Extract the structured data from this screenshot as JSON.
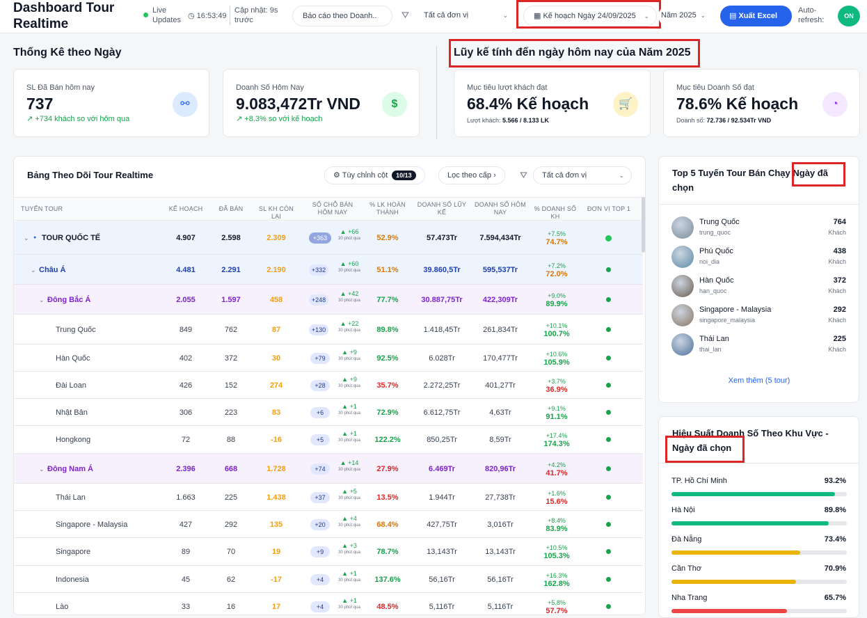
{
  "header": {
    "title": "Dashboard Tour Realtime",
    "live_label": "Live Updates",
    "clock": "16:53:49",
    "updated": "Cập nhật: 9s trước",
    "report_select": "Báo cáo theo Doanh..",
    "unit_select": "Tất cả đơn vị",
    "plan_select": "Kế hoạch Ngày 24/09/2025",
    "year_select": "Năm 2025",
    "export_label": "Xuất Excel",
    "auto_refresh_label": "Auto-refresh:",
    "toggle_label": "ON"
  },
  "daily": {
    "title": "Thống Kê theo Ngày",
    "cards": [
      {
        "label": "SL Đã Bán hôm nay",
        "value": "737",
        "sub": "+734 khách so với hôm qua"
      },
      {
        "label": "Doanh Số Hôm Nay",
        "value": "9.083,472Tr VND",
        "sub": "+8.3% so với kế hoạch"
      }
    ]
  },
  "cumulative": {
    "title": "Lũy kế tính đến ngày hôm nay của Năm 2025",
    "cards": [
      {
        "label": "Mục tiêu lượt khách đạt",
        "value": "68.4% Kế hoạch",
        "sub_label": "Lượt khách:",
        "sub_value": "5.566 / 8.133 LK"
      },
      {
        "label": "Mục tiêu Doanh Số đạt",
        "value": "78.6% Kế hoạch",
        "sub_label": "Doanh số:",
        "sub_value": "72.736 / 92.534Tr VND"
      }
    ]
  },
  "table": {
    "title": "Bảng Theo Dõi Tour Realtime",
    "customize_label": "Tùy chỉnh cột",
    "customize_count": "10/13",
    "filter_level": "Lọc theo cấp",
    "unit_filter": "Tất cả đơn vị",
    "columns": [
      "Tuyến tour",
      "Kế hoạch",
      "Đã bán",
      "SL KH còn lại",
      "Số chỗ bán hôm nay",
      "% LK hoàn thành",
      "Doanh số lũy kế",
      "Doanh số hôm nay",
      "% Doanh số KH",
      "Đơn vị top 1"
    ],
    "ago_text": "30 phút qua",
    "rows": [
      {
        "level": 0,
        "name": "TOUR QUỐC TẾ",
        "plan": "4.907",
        "sold": "2.598",
        "remain": "2.309",
        "badge": "+363",
        "delta": "▲ +66",
        "pct": "52.9%",
        "rev_cum": "57.473Tr",
        "rev_today": "7.594,434Tr",
        "rev_delta": "+7.5%",
        "rev_pct": "74.7%"
      },
      {
        "level": 1,
        "name": "Châu Á",
        "plan": "4.481",
        "sold": "2.291",
        "remain": "2.190",
        "badge": "+332",
        "delta": "▲ +60",
        "pct": "51.1%",
        "rev_cum": "39.860,5Tr",
        "rev_today": "595,537Tr",
        "rev_delta": "+7.2%",
        "rev_pct": "72.0%"
      },
      {
        "level": 2,
        "name": "Đông Bắc Á",
        "plan": "2.055",
        "sold": "1.597",
        "remain": "458",
        "badge": "+248",
        "delta": "▲ +42",
        "pct": "77.7%",
        "rev_cum": "30.887,75Tr",
        "rev_today": "422,309Tr",
        "rev_delta": "+9.0%",
        "rev_pct": "89.9%"
      },
      {
        "level": 3,
        "name": "Trung Quốc",
        "plan": "849",
        "sold": "762",
        "remain": "87",
        "badge": "+130",
        "delta": "▲ +22",
        "pct": "89.8%",
        "rev_cum": "1.418,45Tr",
        "rev_today": "261,834Tr",
        "rev_delta": "+10.1%",
        "rev_pct": "100.7%"
      },
      {
        "level": 3,
        "name": "Hàn Quốc",
        "plan": "402",
        "sold": "372",
        "remain": "30",
        "badge": "+79",
        "delta": "▲ +9",
        "pct": "92.5%",
        "rev_cum": "6.028Tr",
        "rev_today": "170,477Tr",
        "rev_delta": "+10.6%",
        "rev_pct": "105.9%"
      },
      {
        "level": 3,
        "name": "Đài Loan",
        "plan": "426",
        "sold": "152",
        "remain": "274",
        "badge": "+28",
        "delta": "▲ +9",
        "pct": "35.7%",
        "rev_cum": "2.272,25Tr",
        "rev_today": "401,27Tr",
        "rev_delta": "+3.7%",
        "rev_pct": "36.9%"
      },
      {
        "level": 3,
        "name": "Nhật Bản",
        "plan": "306",
        "sold": "223",
        "remain": "83",
        "badge": "+6",
        "delta": "▲ +1",
        "pct": "72.9%",
        "rev_cum": "6.612,75Tr",
        "rev_today": "4,63Tr",
        "rev_delta": "+9.1%",
        "rev_pct": "91.1%"
      },
      {
        "level": 3,
        "name": "Hongkong",
        "plan": "72",
        "sold": "88",
        "remain": "-16",
        "badge": "+5",
        "delta": "▲ +1",
        "pct": "122.2%",
        "rev_cum": "850,25Tr",
        "rev_today": "8,59Tr",
        "rev_delta": "+17.4%",
        "rev_pct": "174.3%"
      },
      {
        "level": 2,
        "name": "Đông Nam Á",
        "plan": "2.396",
        "sold": "668",
        "remain": "1.728",
        "badge": "+74",
        "delta": "▲ +14",
        "pct": "27.9%",
        "rev_cum": "6.469Tr",
        "rev_today": "820,96Tr",
        "rev_delta": "+4.2%",
        "rev_pct": "41.7%"
      },
      {
        "level": 3,
        "name": "Thái Lan",
        "plan": "1.663",
        "sold": "225",
        "remain": "1.438",
        "badge": "+37",
        "delta": "▲ +5",
        "pct": "13.5%",
        "rev_cum": "1.944Tr",
        "rev_today": "27,738Tr",
        "rev_delta": "+1.6%",
        "rev_pct": "15.6%"
      },
      {
        "level": 3,
        "name": "Singapore - Malaysia",
        "plan": "427",
        "sold": "292",
        "remain": "135",
        "badge": "+20",
        "delta": "▲ +4",
        "pct": "68.4%",
        "rev_cum": "427,75Tr",
        "rev_today": "3,016Tr",
        "rev_delta": "+8.4%",
        "rev_pct": "83.9%"
      },
      {
        "level": 3,
        "name": "Singapore",
        "plan": "89",
        "sold": "70",
        "remain": "19",
        "badge": "+9",
        "delta": "▲ +3",
        "pct": "78.7%",
        "rev_cum": "13,143Tr",
        "rev_today": "13,143Tr",
        "rev_delta": "+10.5%",
        "rev_pct": "105.3%"
      },
      {
        "level": 3,
        "name": "Indonesia",
        "plan": "45",
        "sold": "62",
        "remain": "-17",
        "badge": "+4",
        "delta": "▲ +1",
        "pct": "137.6%",
        "rev_cum": "56,16Tr",
        "rev_today": "56,16Tr",
        "rev_delta": "+16.3%",
        "rev_pct": "162.8%"
      },
      {
        "level": 3,
        "name": "Lào",
        "plan": "33",
        "sold": "16",
        "remain": "17",
        "badge": "+4",
        "delta": "▲ +1",
        "pct": "48.5%",
        "rev_cum": "5,116Tr",
        "rev_today": "5,116Tr",
        "rev_delta": "+5.8%",
        "rev_pct": "57.7%"
      }
    ]
  },
  "top5": {
    "title_a": "Top 5 Tuyến Tour Bán Chạy",
    "title_b": "Ngày đã chọn",
    "unit": "Khách",
    "items": [
      {
        "name": "Trung Quốc",
        "code": "trung_quoc",
        "value": "764"
      },
      {
        "name": "Phú Quốc",
        "code": "noi_dia",
        "value": "438"
      },
      {
        "name": "Hàn Quốc",
        "code": "han_quoc",
        "value": "372"
      },
      {
        "name": "Singapore - Malaysia",
        "code": "singapore_malaysia",
        "value": "292"
      },
      {
        "name": "Thái Lan",
        "code": "thai_lan",
        "value": "225"
      }
    ],
    "more": "Xem thêm (5 tour)"
  },
  "regions": {
    "title_a": "Hiệu Suất Doanh Số Theo Khu Vực -",
    "title_b": "Ngày đã chọn",
    "items": [
      {
        "name": "TP. Hồ Chí Minh",
        "value": "93.2%",
        "fraction": 0.932,
        "color": "#10b981"
      },
      {
        "name": "Hà Nội",
        "value": "89.8%",
        "fraction": 0.898,
        "color": "#10b981"
      },
      {
        "name": "Đà Nẵng",
        "value": "73.4%",
        "fraction": 0.734,
        "color": "#eab308"
      },
      {
        "name": "Cần Thơ",
        "value": "70.9%",
        "fraction": 0.709,
        "color": "#eab308"
      },
      {
        "name": "Nha Trang",
        "value": "65.7%",
        "fraction": 0.657,
        "color": "#ef4444"
      }
    ]
  }
}
